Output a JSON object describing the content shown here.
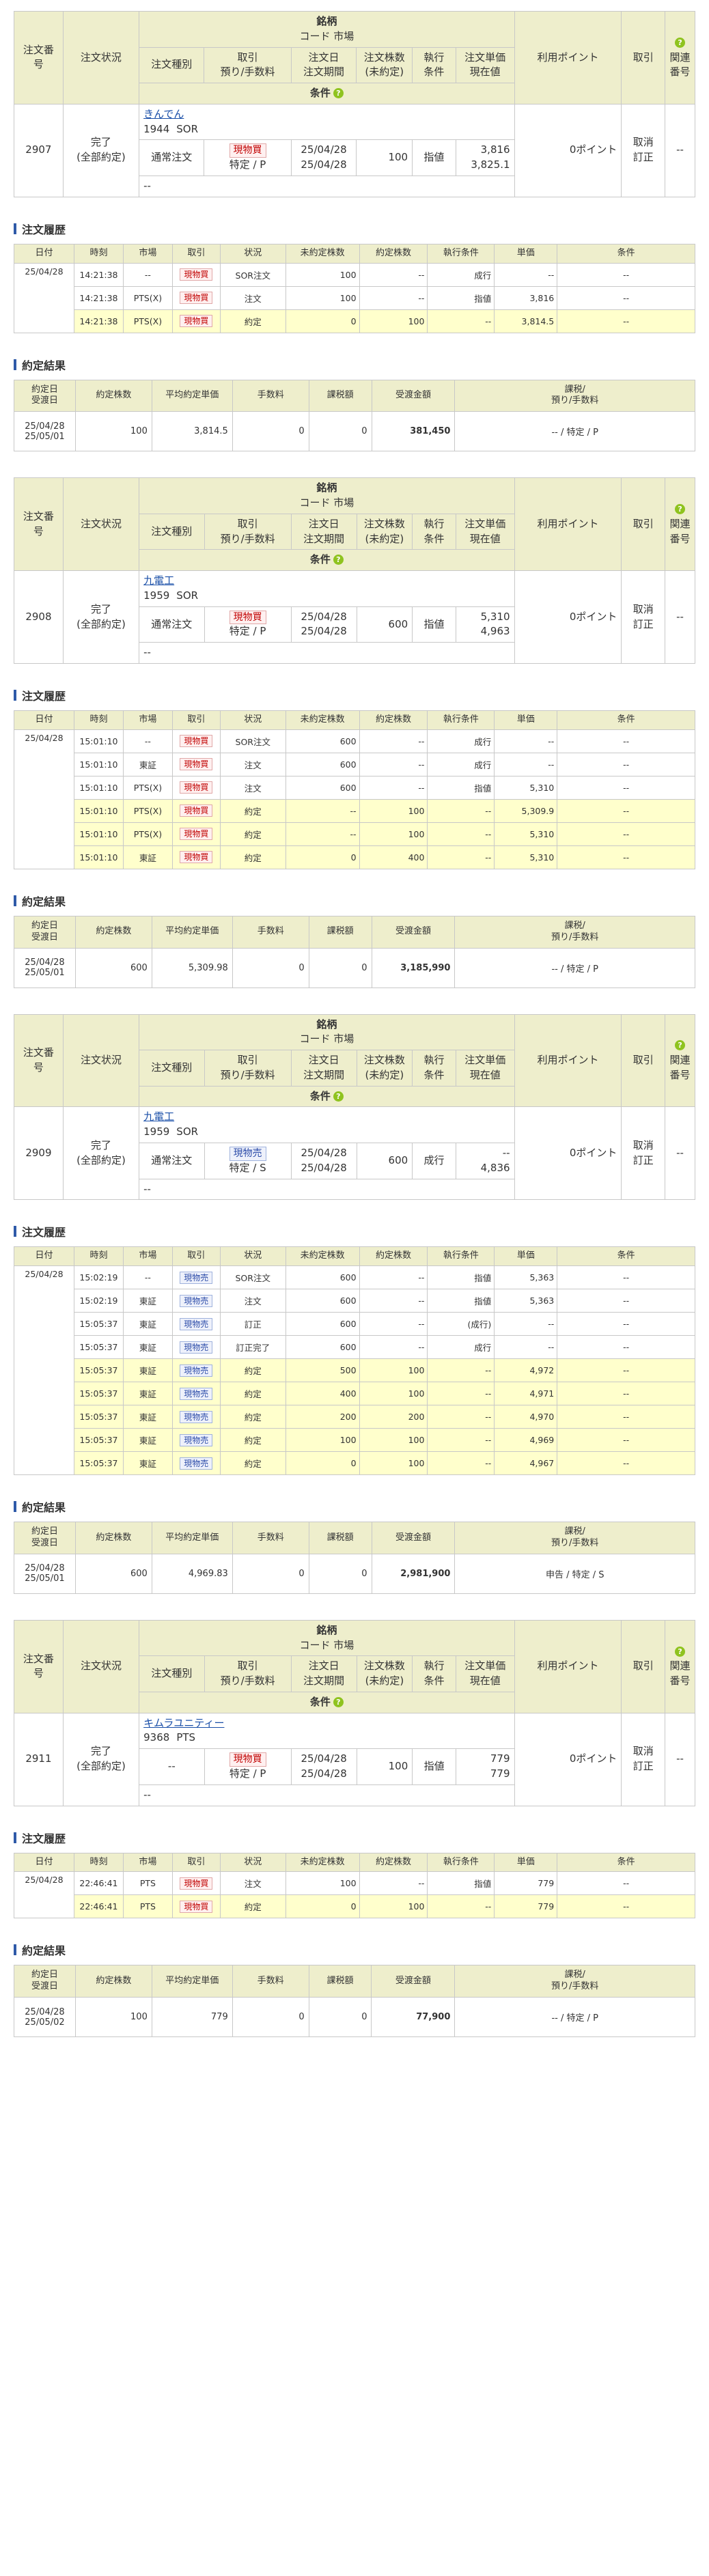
{
  "order_headers": {
    "order_no": "注文番号",
    "status": "注文状況",
    "issue": "銘柄",
    "code_market": "コード 市場",
    "order_type": "注文種別",
    "trade": "取引",
    "account": "預り/手数料",
    "order_date": "注文日",
    "order_period": "注文期間",
    "qty": "注文株数",
    "unfilled": "(未約定)",
    "exec": "執行",
    "cond": "条件",
    "price": "注文単価",
    "current": "現在値",
    "points": "利用ポイント",
    "tori": "取引",
    "related1": "関連",
    "related2": "番号",
    "conditions": "条件",
    "help_icon": "?"
  },
  "history_title": "注文履歴",
  "result_title": "約定結果",
  "history_headers": [
    "日付",
    "時刻",
    "市場",
    "取引",
    "状況",
    "未約定株数",
    "約定株数",
    "執行条件",
    "単価",
    "条件"
  ],
  "result_headers": {
    "date1": "約定日",
    "date2": "受渡日",
    "qty": "約定株数",
    "avg": "平均約定単価",
    "fee": "手数料",
    "tax": "課税額",
    "amount": "受渡金額",
    "acc1": "課税/",
    "acc2": "預り/手数料"
  },
  "orders": [
    {
      "no": "2907",
      "status1": "完了",
      "status2": "(全部約定)",
      "name": "きんでん",
      "code": "1944",
      "market": "SOR",
      "type": "通常注文",
      "trade": "現物買",
      "side": "buy",
      "account": "特定 / P",
      "date": "25/04/28",
      "period": "25/04/28",
      "qty": "100",
      "exec": "指値",
      "price": "3,816",
      "current": "3,825.1",
      "points": "0ポイント",
      "act1": "取消",
      "act2": "訂正",
      "related": "--",
      "cond": "--",
      "history": [
        {
          "date": "25/04/28",
          "time": "14:21:38",
          "market": "--",
          "trade": "現物買",
          "status": "SOR注文",
          "unfilled": "100",
          "filled": "--",
          "exec": "成行",
          "price": "--",
          "cond": "--",
          "hl": false
        },
        {
          "date": "",
          "time": "14:21:38",
          "market": "PTS(X)",
          "trade": "現物買",
          "status": "注文",
          "unfilled": "100",
          "filled": "--",
          "exec": "指値",
          "price": "3,816",
          "cond": "--",
          "hl": false
        },
        {
          "date": "",
          "time": "14:21:38",
          "market": "PTS(X)",
          "trade": "現物買",
          "status": "約定",
          "unfilled": "0",
          "filled": "100",
          "exec": "--",
          "price": "3,814.5",
          "cond": "--",
          "hl": true
        }
      ],
      "result": {
        "date1": "25/04/28",
        "date2": "25/05/01",
        "qty": "100",
        "avg": "3,814.5",
        "fee": "0",
        "tax": "0",
        "amount": "381,450",
        "account": "-- / 特定 / P"
      }
    },
    {
      "no": "2908",
      "status1": "完了",
      "status2": "(全部約定)",
      "name": "九電工",
      "code": "1959",
      "market": "SOR",
      "type": "通常注文",
      "trade": "現物買",
      "side": "buy",
      "account": "特定 / P",
      "date": "25/04/28",
      "period": "25/04/28",
      "qty": "600",
      "exec": "指値",
      "price": "5,310",
      "current": "4,963",
      "points": "0ポイント",
      "act1": "取消",
      "act2": "訂正",
      "related": "--",
      "cond": "--",
      "history": [
        {
          "date": "25/04/28",
          "time": "15:01:10",
          "market": "--",
          "trade": "現物買",
          "status": "SOR注文",
          "unfilled": "600",
          "filled": "--",
          "exec": "成行",
          "price": "--",
          "cond": "--",
          "hl": false
        },
        {
          "date": "",
          "time": "15:01:10",
          "market": "東証",
          "trade": "現物買",
          "status": "注文",
          "unfilled": "600",
          "filled": "--",
          "exec": "成行",
          "price": "--",
          "cond": "--",
          "hl": false
        },
        {
          "date": "",
          "time": "15:01:10",
          "market": "PTS(X)",
          "trade": "現物買",
          "status": "注文",
          "unfilled": "600",
          "filled": "--",
          "exec": "指値",
          "price": "5,310",
          "cond": "--",
          "hl": false
        },
        {
          "date": "",
          "time": "15:01:10",
          "market": "PTS(X)",
          "trade": "現物買",
          "status": "約定",
          "unfilled": "--",
          "filled": "100",
          "exec": "--",
          "price": "5,309.9",
          "cond": "--",
          "hl": true
        },
        {
          "date": "",
          "time": "15:01:10",
          "market": "PTS(X)",
          "trade": "現物買",
          "status": "約定",
          "unfilled": "--",
          "filled": "100",
          "exec": "--",
          "price": "5,310",
          "cond": "--",
          "hl": true
        },
        {
          "date": "",
          "time": "15:01:10",
          "market": "東証",
          "trade": "現物買",
          "status": "約定",
          "unfilled": "0",
          "filled": "400",
          "exec": "--",
          "price": "5,310",
          "cond": "--",
          "hl": true
        }
      ],
      "result": {
        "date1": "25/04/28",
        "date2": "25/05/01",
        "qty": "600",
        "avg": "5,309.98",
        "fee": "0",
        "tax": "0",
        "amount": "3,185,990",
        "account": "-- / 特定 / P"
      }
    },
    {
      "no": "2909",
      "status1": "完了",
      "status2": "(全部約定)",
      "name": "九電工",
      "code": "1959",
      "market": "SOR",
      "type": "通常注文",
      "trade": "現物売",
      "side": "sell",
      "account": "特定 / S",
      "date": "25/04/28",
      "period": "25/04/28",
      "qty": "600",
      "exec": "成行",
      "price": "--",
      "current": "4,836",
      "points": "0ポイント",
      "act1": "取消",
      "act2": "訂正",
      "related": "--",
      "cond": "--",
      "history": [
        {
          "date": "25/04/28",
          "time": "15:02:19",
          "market": "--",
          "trade": "現物売",
          "status": "SOR注文",
          "unfilled": "600",
          "filled": "--",
          "exec": "指値",
          "price": "5,363",
          "cond": "--",
          "hl": false
        },
        {
          "date": "",
          "time": "15:02:19",
          "market": "東証",
          "trade": "現物売",
          "status": "注文",
          "unfilled": "600",
          "filled": "--",
          "exec": "指値",
          "price": "5,363",
          "cond": "--",
          "hl": false
        },
        {
          "date": "",
          "time": "15:05:37",
          "market": "東証",
          "trade": "現物売",
          "status": "訂正",
          "unfilled": "600",
          "filled": "--",
          "exec": "(成行)",
          "price": "--",
          "cond": "--",
          "hl": false
        },
        {
          "date": "",
          "time": "15:05:37",
          "market": "東証",
          "trade": "現物売",
          "status": "訂正完了",
          "unfilled": "600",
          "filled": "--",
          "exec": "成行",
          "price": "--",
          "cond": "--",
          "hl": false
        },
        {
          "date": "",
          "time": "15:05:37",
          "market": "東証",
          "trade": "現物売",
          "status": "約定",
          "unfilled": "500",
          "filled": "100",
          "exec": "--",
          "price": "4,972",
          "cond": "--",
          "hl": true
        },
        {
          "date": "",
          "time": "15:05:37",
          "market": "東証",
          "trade": "現物売",
          "status": "約定",
          "unfilled": "400",
          "filled": "100",
          "exec": "--",
          "price": "4,971",
          "cond": "--",
          "hl": true
        },
        {
          "date": "",
          "time": "15:05:37",
          "market": "東証",
          "trade": "現物売",
          "status": "約定",
          "unfilled": "200",
          "filled": "200",
          "exec": "--",
          "price": "4,970",
          "cond": "--",
          "hl": true
        },
        {
          "date": "",
          "time": "15:05:37",
          "market": "東証",
          "trade": "現物売",
          "status": "約定",
          "unfilled": "100",
          "filled": "100",
          "exec": "--",
          "price": "4,969",
          "cond": "--",
          "hl": true
        },
        {
          "date": "",
          "time": "15:05:37",
          "market": "東証",
          "trade": "現物売",
          "status": "約定",
          "unfilled": "0",
          "filled": "100",
          "exec": "--",
          "price": "4,967",
          "cond": "--",
          "hl": true
        }
      ],
      "result": {
        "date1": "25/04/28",
        "date2": "25/05/01",
        "qty": "600",
        "avg": "4,969.83",
        "fee": "0",
        "tax": "0",
        "amount": "2,981,900",
        "account": "申告 / 特定 / S"
      }
    },
    {
      "no": "2911",
      "status1": "完了",
      "status2": "(全部約定)",
      "name": "キムラユニティー",
      "code": "9368",
      "market": "PTS",
      "type": "--",
      "trade": "現物買",
      "side": "buy",
      "account": "特定 / P",
      "date": "25/04/28",
      "period": "25/04/28",
      "qty": "100",
      "exec": "指値",
      "price": "779",
      "current": "779",
      "points": "0ポイント",
      "act1": "取消",
      "act2": "訂正",
      "related": "--",
      "cond": "--",
      "history": [
        {
          "date": "25/04/28",
          "time": "22:46:41",
          "market": "PTS",
          "trade": "現物買",
          "status": "注文",
          "unfilled": "100",
          "filled": "--",
          "exec": "指値",
          "price": "779",
          "cond": "--",
          "hl": false
        },
        {
          "date": "",
          "time": "22:46:41",
          "market": "PTS",
          "trade": "現物買",
          "status": "約定",
          "unfilled": "0",
          "filled": "100",
          "exec": "--",
          "price": "779",
          "cond": "--",
          "hl": true
        }
      ],
      "result": {
        "date1": "25/04/28",
        "date2": "25/05/02",
        "qty": "100",
        "avg": "779",
        "fee": "0",
        "tax": "0",
        "amount": "77,900",
        "account": "-- / 特定 / P"
      }
    }
  ]
}
